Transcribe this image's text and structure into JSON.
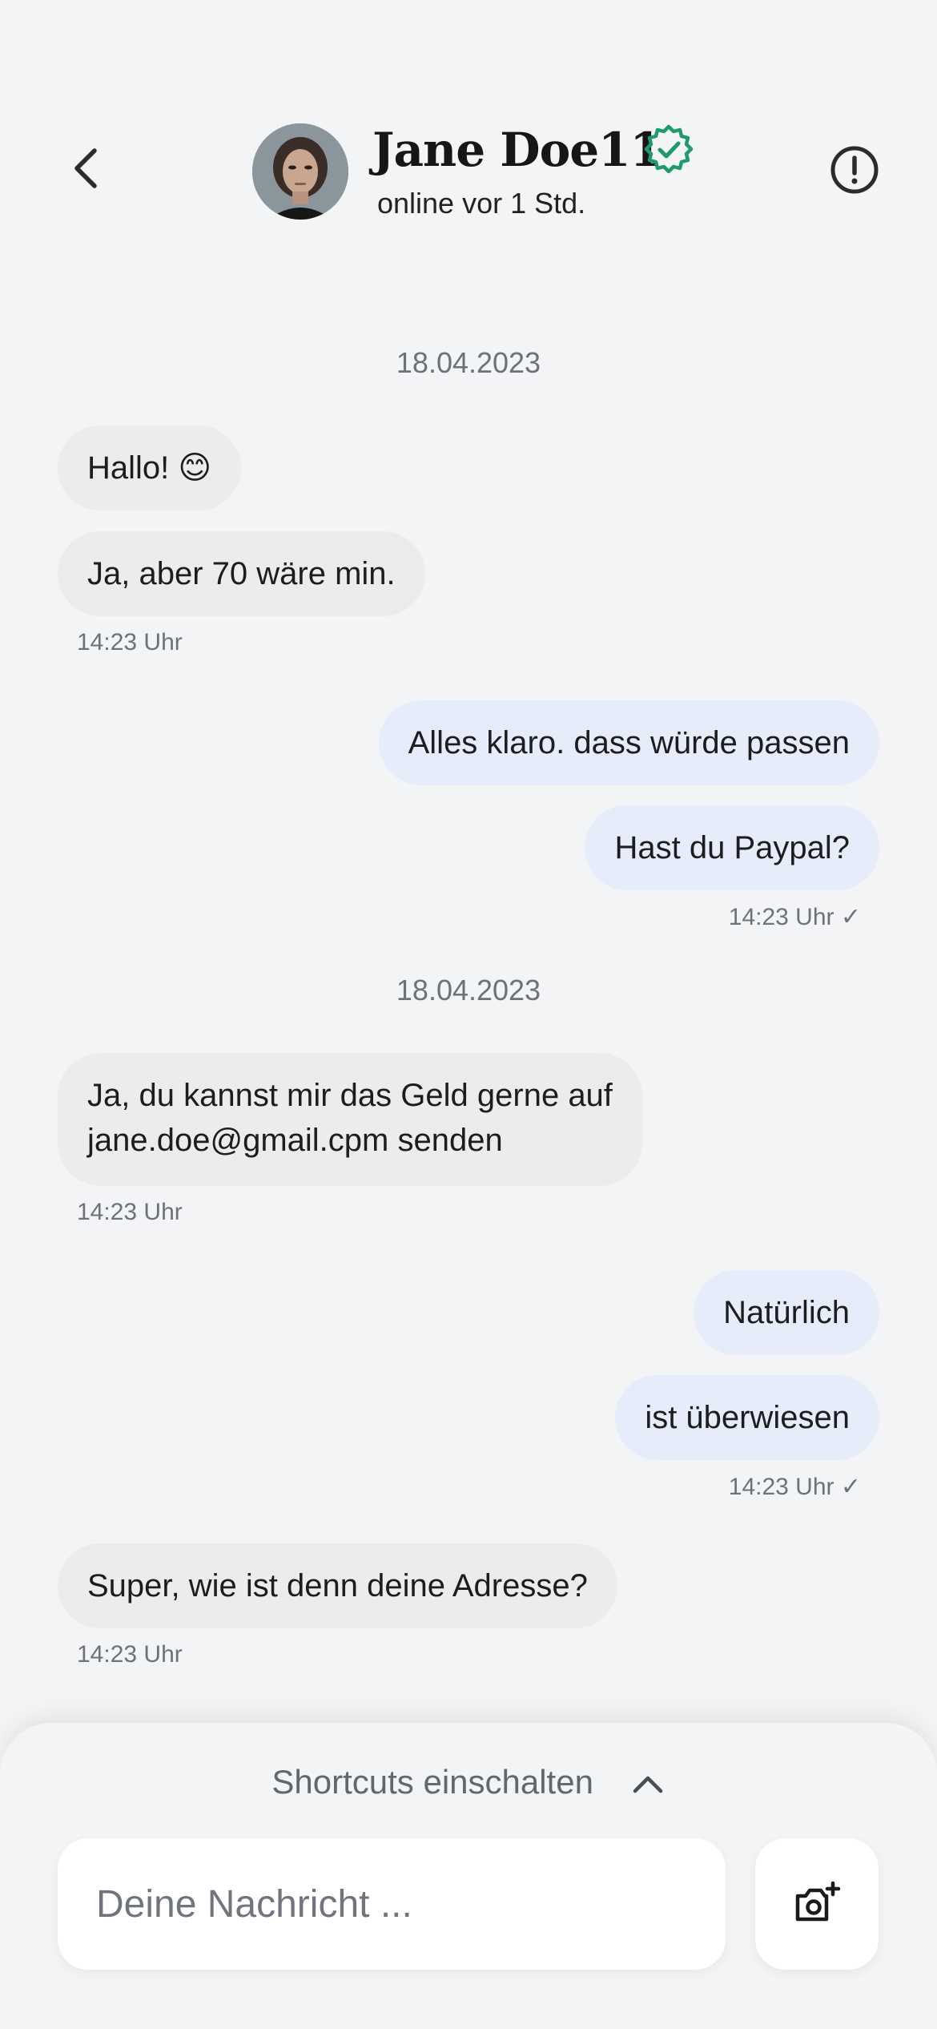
{
  "header": {
    "contact_name": "Jane Doe11",
    "status": "online vor 1 Std."
  },
  "icons": {
    "back": "chevron-left-icon",
    "verified": "verified-badge-icon",
    "report": "alert-circle-icon",
    "shortcuts_toggle": "chevron-up-icon",
    "camera": "camera-plus-icon"
  },
  "colors": {
    "background": "#f3f4f6",
    "incoming_bubble": "#ececec",
    "outgoing_bubble": "#e7ecfb",
    "verified_badge": "#1f9a6b"
  },
  "chat": {
    "date_1": "18.04.2023",
    "msg_1": "Hallo! 😊",
    "msg_2": "Ja, aber 70 wäre min.",
    "time_1": "14:23 Uhr",
    "msg_3": "Alles klaro. dass würde passen",
    "msg_4": "Hast du Paypal?",
    "time_2": "14:23 Uhr ✓",
    "date_2": "18.04.2023",
    "msg_5_line1": "Ja, du kannst mir das Geld gerne auf",
    "msg_5_line2": "jane.doe@gmail.cpm senden",
    "time_3": "14:23 Uhr",
    "msg_6": "Natürlich",
    "msg_7": "ist überwiesen",
    "time_4": "14:23 Uhr ✓",
    "msg_8": "Super, wie ist denn deine Adresse?",
    "time_5": "14:23 Uhr"
  },
  "composer": {
    "shortcuts_label": "Shortcuts einschalten",
    "input_placeholder": "Deine Nachricht ..."
  }
}
